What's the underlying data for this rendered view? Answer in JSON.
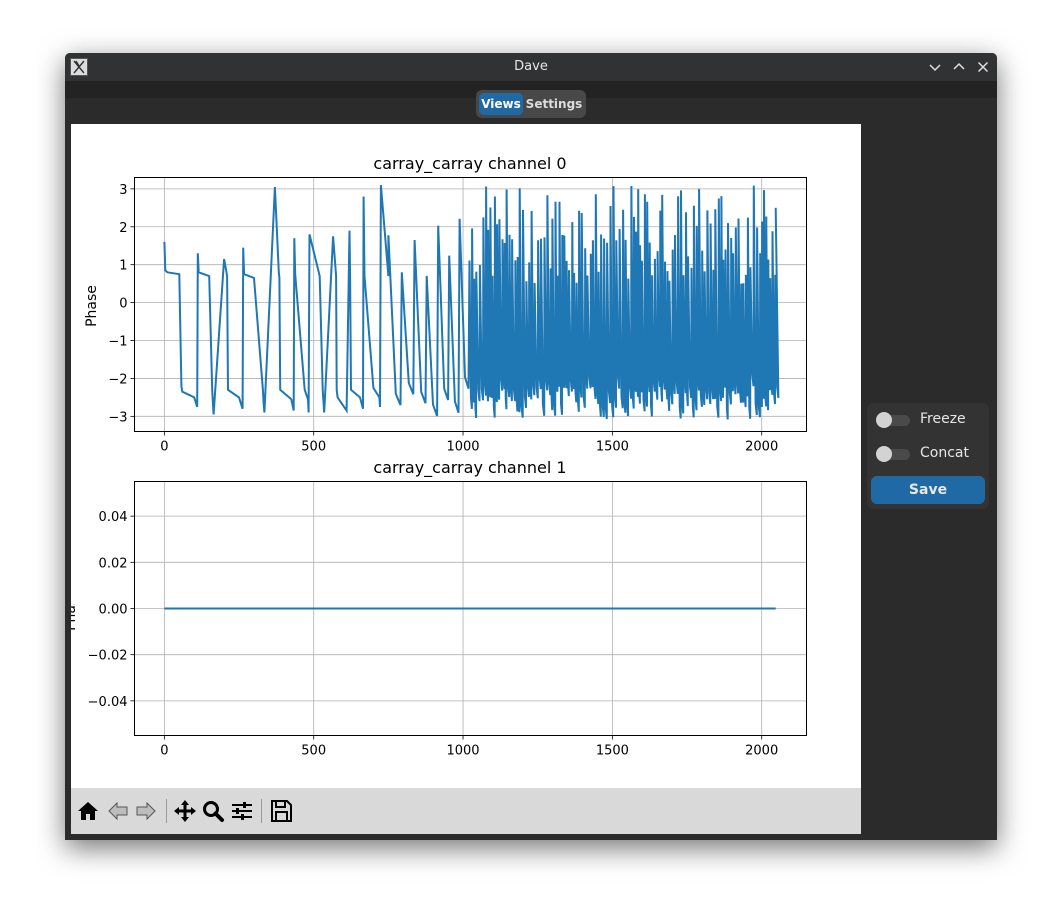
{
  "window": {
    "title": "Dave"
  },
  "tabs": [
    {
      "label": "Views",
      "active": true
    },
    {
      "label": "Settings",
      "active": false
    }
  ],
  "side_panel": {
    "freeze": {
      "label": "Freeze",
      "on": false
    },
    "concat": {
      "label": "Concat",
      "on": false
    },
    "save_label": "Save"
  },
  "toolbar": {
    "buttons": [
      "home-icon",
      "back-arrow-icon",
      "forward-arrow-icon",
      "pan-icon",
      "zoom-icon",
      "configure-subplots-icon",
      "save-figure-icon"
    ]
  },
  "colors": {
    "accent": "#1f6aa5",
    "series": "#1f77b4",
    "titlebar": "#303233",
    "panel": "#333333"
  },
  "chart_data": [
    {
      "type": "line",
      "title": "carray_carray channel 0",
      "xlabel": "",
      "ylabel": "Phase",
      "xlim": [
        -100,
        2150
      ],
      "ylim": [
        -3.4,
        3.3
      ],
      "xticks": [
        0,
        500,
        1000,
        1500,
        2000
      ],
      "xtick_labels": [
        "0",
        "500",
        "1000",
        "1500",
        "2000"
      ],
      "yticks": [
        3,
        2,
        1,
        0,
        -1,
        -2,
        -3
      ],
      "ytick_labels": [
        "3",
        "2",
        "1",
        "0",
        "−1",
        "−2",
        "−3"
      ],
      "grid": true,
      "series": [
        {
          "description": "phase sawtooth, wrapping between about -3.14 and +3.14; period shrinks as sample index grows",
          "x": [
            0,
            3,
            10,
            50,
            57,
            60,
            100,
            110,
            112,
            115,
            150,
            160,
            162,
            165,
            200,
            208,
            210,
            213,
            250,
            262,
            264,
            267,
            300,
            330,
            332,
            335,
            370,
            383,
            385,
            388,
            425,
            433,
            435,
            438,
            470,
            481,
            483,
            486,
            520,
            530,
            532,
            535,
            565,
            575,
            577,
            580,
            610,
            620,
            622,
            625,
            655,
            665,
            667,
            670,
            700,
            720,
            722,
            725,
            750
          ],
          "y": [
            1.6,
            0.85,
            0.8,
            0.75,
            -2.2,
            -2.35,
            -2.5,
            -2.75,
            1.3,
            0.8,
            0.7,
            -2.3,
            -2.6,
            -2.95,
            1.15,
            0.8,
            0.7,
            -2.3,
            -2.5,
            -2.8,
            1.45,
            0.75,
            0.65,
            -2.3,
            -2.6,
            -2.9,
            3.05,
            0.8,
            0.65,
            -2.3,
            -2.55,
            -2.85,
            1.7,
            0.75,
            -2.3,
            -2.55,
            -2.9,
            1.8,
            0.7,
            -2.3,
            -2.55,
            -2.9,
            1.75,
            0.7,
            -2.3,
            -2.5,
            -2.85,
            1.9,
            0.7,
            -2.3,
            -2.5,
            -2.8,
            2.8,
            0.7,
            -2.25,
            -2.5,
            -2.75,
            3.1,
            0.7
          ]
        }
      ]
    },
    {
      "type": "line",
      "title": "carray_carray channel 1",
      "xlabel": "",
      "ylabel": "Phase",
      "xlim": [
        -100,
        2150
      ],
      "ylim": [
        -0.055,
        0.055
      ],
      "xticks": [
        0,
        500,
        1000,
        1500,
        2000
      ],
      "xtick_labels": [
        "0",
        "500",
        "1000",
        "1500",
        "2000"
      ],
      "yticks": [
        0.04,
        0.02,
        0.0,
        -0.02,
        -0.04
      ],
      "ytick_labels": [
        "0.04",
        "0.02",
        "0.00",
        "−0.02",
        "−0.04"
      ],
      "grid": true,
      "series": [
        {
          "x": [
            0,
            2047
          ],
          "y": [
            0.0,
            0.0
          ]
        }
      ]
    }
  ]
}
